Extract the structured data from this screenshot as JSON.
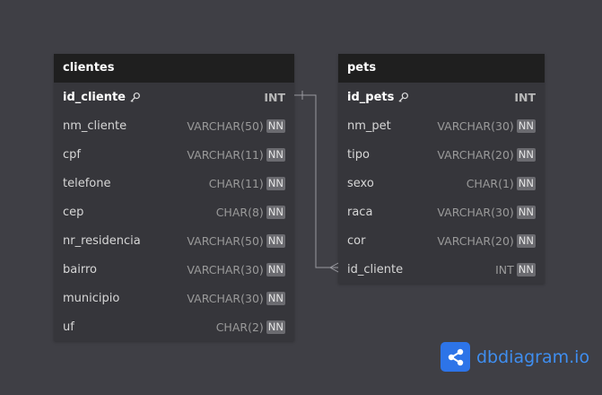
{
  "tables": {
    "clientes": {
      "name": "clientes",
      "columns": [
        {
          "name": "id_cliente",
          "type": "INT",
          "pk": true,
          "nn": ""
        },
        {
          "name": "nm_cliente",
          "type": "VARCHAR(50)",
          "pk": false,
          "nn": "NN"
        },
        {
          "name": "cpf",
          "type": "VARCHAR(11)",
          "pk": false,
          "nn": "NN"
        },
        {
          "name": "telefone",
          "type": "CHAR(11)",
          "pk": false,
          "nn": "NN"
        },
        {
          "name": "cep",
          "type": "CHAR(8)",
          "pk": false,
          "nn": "NN"
        },
        {
          "name": "nr_residencia",
          "type": "VARCHAR(50)",
          "pk": false,
          "nn": "NN"
        },
        {
          "name": "bairro",
          "type": "VARCHAR(30)",
          "pk": false,
          "nn": "NN"
        },
        {
          "name": "municipio",
          "type": "VARCHAR(30)",
          "pk": false,
          "nn": "NN"
        },
        {
          "name": "uf",
          "type": "CHAR(2)",
          "pk": false,
          "nn": "NN"
        }
      ]
    },
    "pets": {
      "name": "pets",
      "columns": [
        {
          "name": "id_pets",
          "type": "INT",
          "pk": true,
          "nn": ""
        },
        {
          "name": "nm_pet",
          "type": "VARCHAR(30)",
          "pk": false,
          "nn": "NN"
        },
        {
          "name": "tipo",
          "type": "VARCHAR(20)",
          "pk": false,
          "nn": "NN"
        },
        {
          "name": "sexo",
          "type": "CHAR(1)",
          "pk": false,
          "nn": "NN"
        },
        {
          "name": "raca",
          "type": "VARCHAR(30)",
          "pk": false,
          "nn": "NN"
        },
        {
          "name": "cor",
          "type": "VARCHAR(20)",
          "pk": false,
          "nn": "NN"
        },
        {
          "name": "id_cliente",
          "type": "INT",
          "pk": false,
          "nn": "NN"
        }
      ]
    }
  },
  "relationship": {
    "from": "clientes.id_cliente",
    "to": "pets.id_cliente",
    "from_cardinality": "one",
    "to_cardinality": "many"
  },
  "branding": {
    "text": "dbdiagram.io"
  },
  "icons": {
    "key": "key-icon",
    "logo": "share-icon"
  },
  "colors": {
    "background": "#3f3f45",
    "header": "#1f1f1f",
    "body": "#36363b",
    "brand": "#2d74e8"
  }
}
